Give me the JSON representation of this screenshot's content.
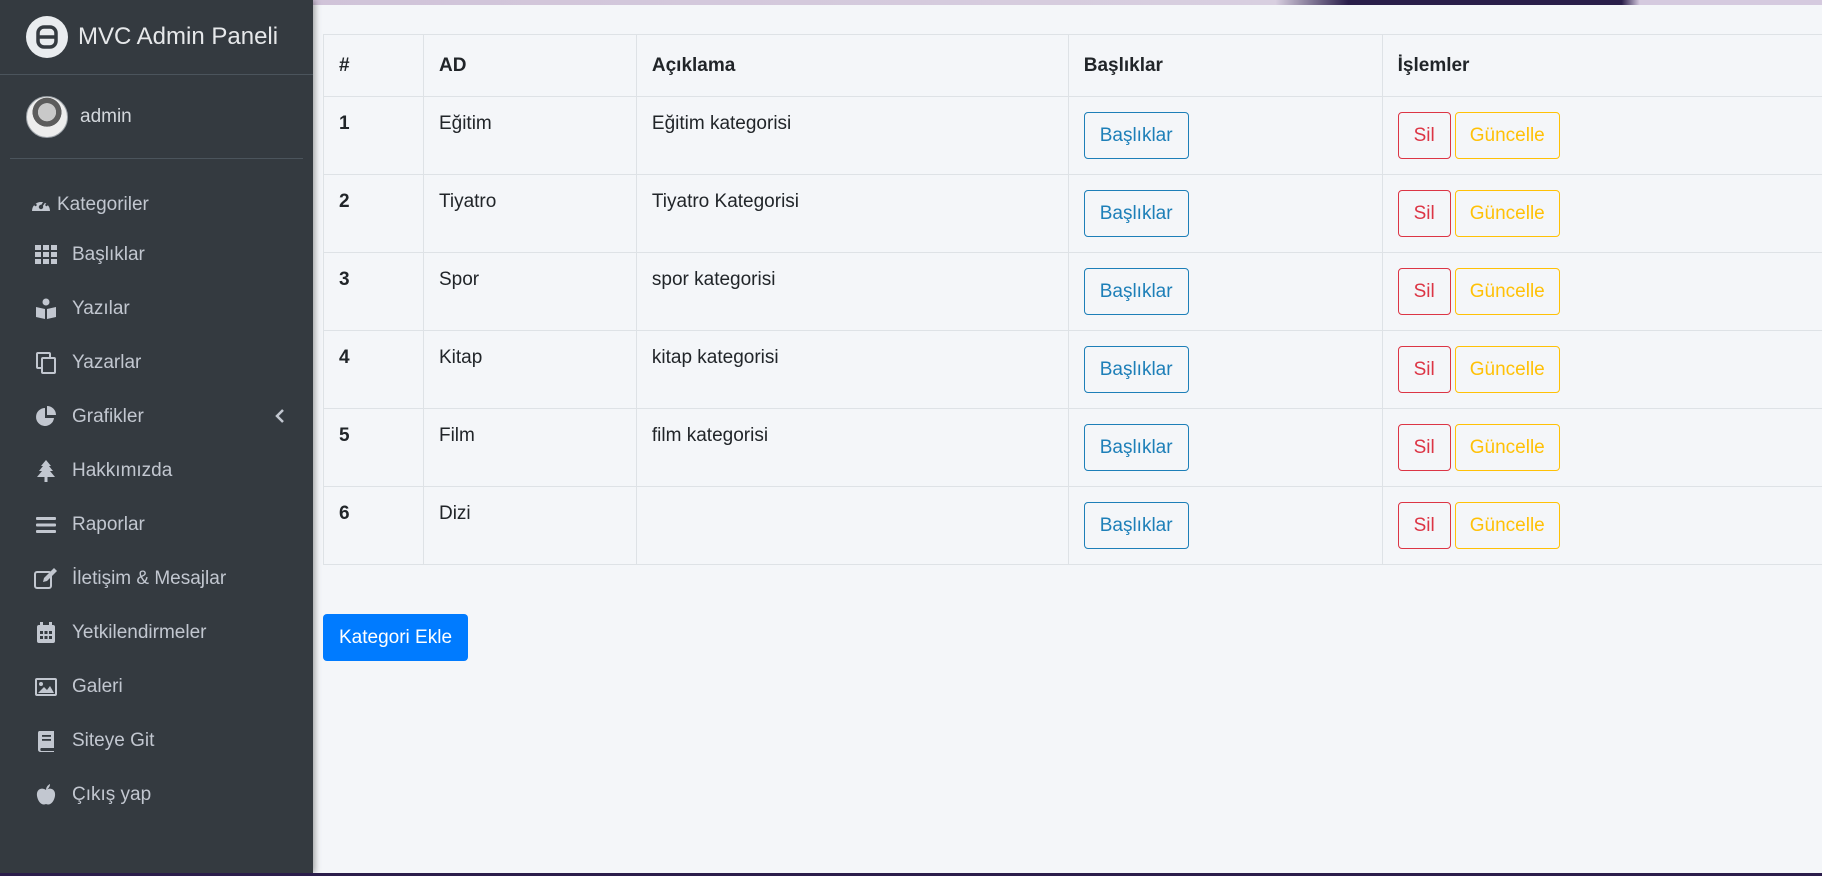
{
  "app": {
    "brand_title": "MVC Admin Paneli",
    "username": "admin"
  },
  "sidebar": {
    "items": [
      {
        "label": "Kategoriler",
        "icon": "tachometer-icon"
      },
      {
        "label": "Başlıklar",
        "icon": "grid-icon"
      },
      {
        "label": "Yazılar",
        "icon": "book-reader-icon"
      },
      {
        "label": "Yazarlar",
        "icon": "copy-icon"
      },
      {
        "label": "Grafikler",
        "icon": "chart-pie-icon"
      },
      {
        "label": "Hakkımızda",
        "icon": "tree-icon"
      },
      {
        "label": "Raporlar",
        "icon": "bars-icon"
      },
      {
        "label": "İletişim & Mesajlar",
        "icon": "edit-icon"
      },
      {
        "label": "Yetkilendirmeler",
        "icon": "calendar-icon"
      },
      {
        "label": "Galeri",
        "icon": "image-icon"
      },
      {
        "label": "Siteye Git",
        "icon": "book-icon"
      },
      {
        "label": "Çıkış yap",
        "icon": "apple-icon"
      }
    ]
  },
  "table": {
    "headers": [
      "#",
      "AD",
      "Açıklama",
      "Başlıklar",
      "İşlemler"
    ],
    "rows": [
      {
        "id": "1",
        "name": "Eğitim",
        "desc": "Eğitim kategorisi"
      },
      {
        "id": "2",
        "name": "Tiyatro",
        "desc": "Tiyatro Kategorisi"
      },
      {
        "id": "3",
        "name": "Spor",
        "desc": "spor kategorisi"
      },
      {
        "id": "4",
        "name": "Kitap",
        "desc": "kitap kategorisi"
      },
      {
        "id": "5",
        "name": "Film",
        "desc": "film kategorisi"
      },
      {
        "id": "6",
        "name": "Dizi",
        "desc": ""
      }
    ],
    "btn_titles": "Başlıklar",
    "btn_delete": "Sil",
    "btn_update": "Güncelle"
  },
  "actions": {
    "add_category": "Kategori Ekle"
  },
  "colors": {
    "sidebar_bg": "#343a40",
    "info": "#1d7fb8",
    "danger": "#dc3545",
    "warning": "#ffc107",
    "primary": "#007bff"
  }
}
